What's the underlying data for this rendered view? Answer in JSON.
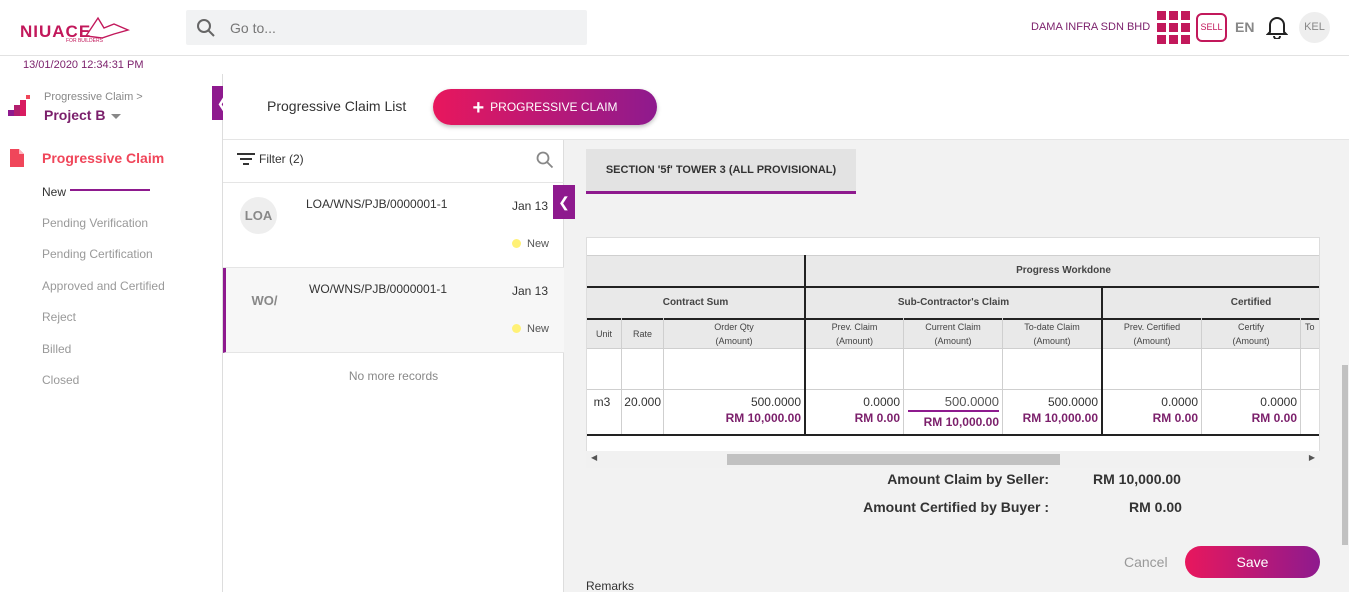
{
  "header": {
    "logo_text": "NIUACE",
    "logo_sub": "FOR BUILDERS",
    "search_placeholder": "Go to...",
    "company": "DAMA INFRA SDN BHD",
    "sell_label": "SELL",
    "language": "EN",
    "avatar_initials": "KEL",
    "accent_color": "#c2185b"
  },
  "datetime": "13/01/2020 12:34:31 PM",
  "sidebar": {
    "breadcrumb": "Progressive Claim >",
    "project": "Project B",
    "section_title": "Progressive Claim",
    "items": [
      {
        "label": "New"
      },
      {
        "label": "Pending Verification"
      },
      {
        "label": "Pending Certification"
      },
      {
        "label": "Approved and Certified"
      },
      {
        "label": "Reject"
      },
      {
        "label": "Billed"
      },
      {
        "label": "Closed"
      }
    ]
  },
  "content": {
    "list_title": "Progressive Claim List",
    "add_button": "PROGRESSIVE CLAIM"
  },
  "list": {
    "filter_label": "Filter (2)",
    "records": [
      {
        "badge": "LOA",
        "ref": "LOA/WNS/PJB/0000001-1",
        "date": "Jan 13",
        "status": "New"
      },
      {
        "badge": "WO/",
        "ref": "WO/WNS/PJB/0000001-1",
        "date": "Jan 13",
        "status": "New"
      }
    ],
    "end_text": "No more records"
  },
  "detail": {
    "section_tab": "SECTION '5f' TOWER 3 (ALL PROVISIONAL)",
    "table": {
      "group_progress": "Progress Workdone",
      "group_contract": "Contract Sum",
      "group_subcon": "Sub-Contractor's Claim",
      "group_certified": "Certified",
      "col_unit": "Unit",
      "col_rate": "Rate",
      "col_orderqty": "Order Qty",
      "col_prevclaim": "Prev. Claim",
      "col_currclaim": "Current Claim",
      "col_todateclaim": "To-date Claim",
      "col_prevcert": "Prev. Certified",
      "col_certify": "Certify",
      "col_partial": "To",
      "amount_sub": "(Amount)",
      "row": {
        "unit": "m3",
        "rate": "20.000",
        "order_qty": "500.0000",
        "order_amt": "RM 10,000.00",
        "prev_claim": "0.0000",
        "prev_claim_amt": "RM 0.00",
        "curr_claim": "500.0000",
        "curr_claim_amt": "RM 10,000.00",
        "todate_claim": "500.0000",
        "todate_claim_amt": "RM 10,000.00",
        "prev_cert": "0.0000",
        "prev_cert_amt": "RM 0.00",
        "certify": "0.0000",
        "certify_amt": "RM 0.00"
      }
    },
    "amount_claim_label": "Amount Claim by Seller:",
    "amount_claim_value": "RM 10,000.00",
    "amount_cert_label": "Amount Certified by Buyer :",
    "amount_cert_value": "RM 0.00",
    "cancel_label": "Cancel",
    "save_label": "Save",
    "remarks_label": "Remarks"
  }
}
